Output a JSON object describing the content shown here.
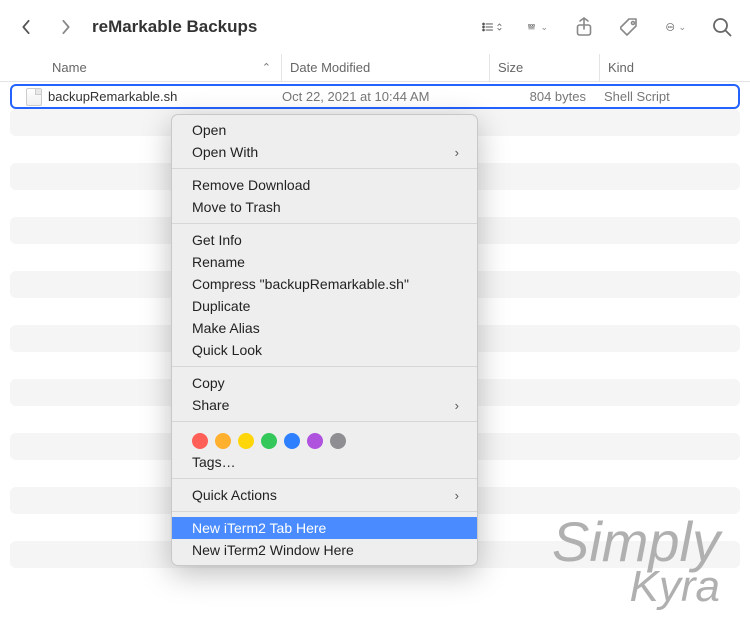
{
  "toolbar": {
    "title": "reMarkable Backups"
  },
  "columns": {
    "name": "Name",
    "date": "Date Modified",
    "size": "Size",
    "kind": "Kind"
  },
  "file": {
    "name": "backupRemarkable.sh",
    "date": "Oct 22, 2021 at 10:44 AM",
    "size": "804 bytes",
    "kind": "Shell Script"
  },
  "menu": {
    "open": "Open",
    "openWith": "Open With",
    "removeDownload": "Remove Download",
    "trash": "Move to Trash",
    "getInfo": "Get Info",
    "rename": "Rename",
    "compress": "Compress \"backupRemarkable.sh\"",
    "duplicate": "Duplicate",
    "makeAlias": "Make Alias",
    "quickLook": "Quick Look",
    "copy": "Copy",
    "share": "Share",
    "tags": "Tags…",
    "quickActions": "Quick Actions",
    "newTab": "New iTerm2 Tab Here",
    "newWindow": "New iTerm2 Window Here"
  },
  "tagColors": [
    "#ff5f57",
    "#ffb02e",
    "#ffd60a",
    "#34c759",
    "#2f80ff",
    "#af52de",
    "#8e8e93"
  ],
  "watermark": {
    "line1": "Simply",
    "line2": "Kyra"
  }
}
